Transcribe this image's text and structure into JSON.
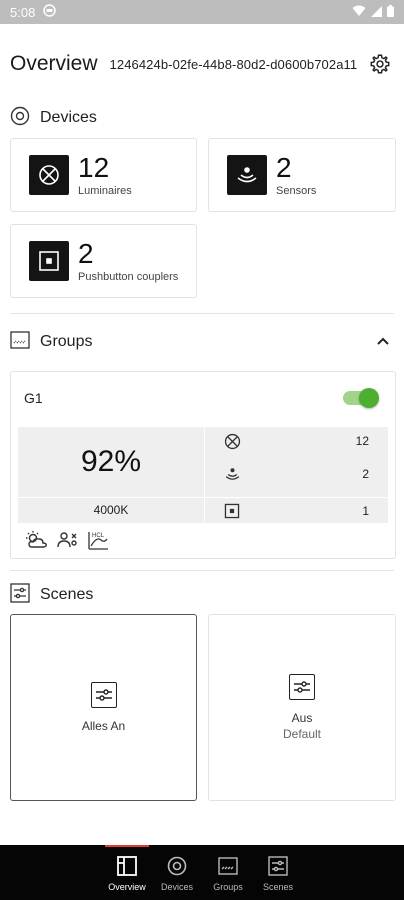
{
  "status_bar": {
    "time": "5:08"
  },
  "header": {
    "title": "Overview",
    "uid": "1246424b-02fe-44b8-80d2-d0600b702a11"
  },
  "devices_section": {
    "title": "Devices",
    "cards": [
      {
        "count": "12",
        "label": "Luminaires",
        "icon": "luminaire-icon"
      },
      {
        "count": "2",
        "label": "Sensors",
        "icon": "sensor-icon"
      },
      {
        "count": "2",
        "label": "Pushbutton couplers",
        "icon": "pushbutton-icon"
      }
    ]
  },
  "groups_section": {
    "title": "Groups",
    "group": {
      "name": "G1",
      "enabled": true,
      "brightness": "92%",
      "color_temp": "4000K",
      "rows": [
        {
          "icon": "luminaire-icon",
          "value": "12"
        },
        {
          "icon": "sensor-icon",
          "value": "2"
        },
        {
          "icon": "pushbutton-icon",
          "value": "1"
        }
      ],
      "features": [
        "daylight-icon",
        "presence-icon",
        "hcl-icon"
      ],
      "hcl_label": "HCL"
    }
  },
  "scenes_section": {
    "title": "Scenes",
    "scenes": [
      {
        "name": "Alles An",
        "sub": ""
      },
      {
        "name": "Aus",
        "sub": "Default"
      }
    ]
  },
  "bottom_nav": {
    "items": [
      {
        "label": "Overview",
        "active": true
      },
      {
        "label": "Devices",
        "active": false
      },
      {
        "label": "Groups",
        "active": false
      },
      {
        "label": "Scenes",
        "active": false
      }
    ]
  },
  "colors": {
    "accent_green": "#4caf30",
    "active_indicator": "#e53935",
    "nav_bg": "#050505"
  }
}
